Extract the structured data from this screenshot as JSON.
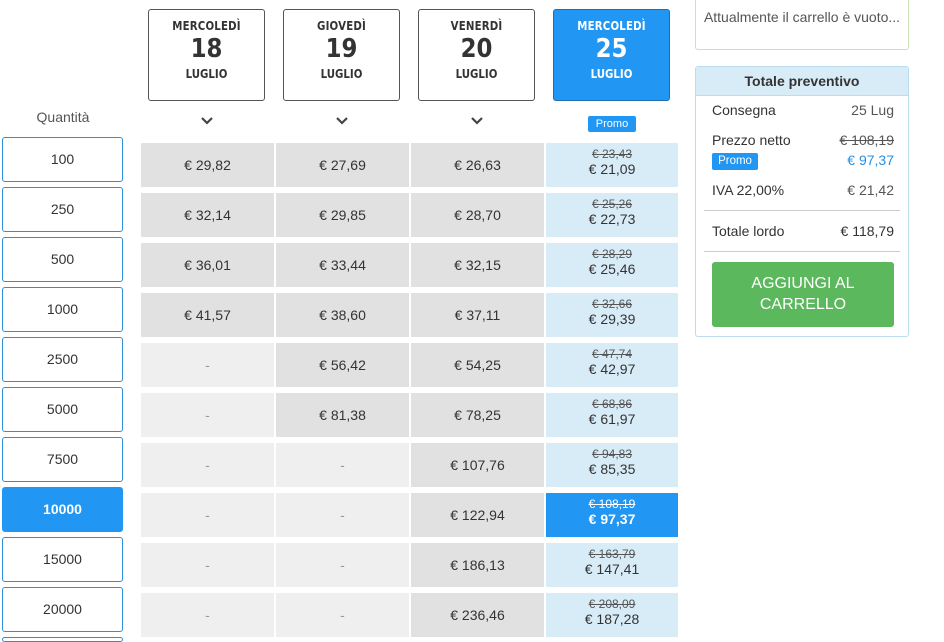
{
  "dates": [
    {
      "weekday": "MERCOLEDÌ",
      "day": "18",
      "month": "LUGLIO"
    },
    {
      "weekday": "GIOVEDÌ",
      "day": "19",
      "month": "LUGLIO"
    },
    {
      "weekday": "VENERDÌ",
      "day": "20",
      "month": "LUGLIO"
    },
    {
      "weekday": "MERCOLEDÌ",
      "day": "25",
      "month": "LUGLIO"
    }
  ],
  "promo_label": "Promo",
  "quantity_label": "Quantità",
  "quantities": [
    "100",
    "250",
    "500",
    "1000",
    "2500",
    "5000",
    "7500",
    "10000",
    "15000",
    "20000"
  ],
  "rows": [
    {
      "c1": "€ 29,82",
      "c2": "€ 27,69",
      "c3": "€ 26,63",
      "old": "€ 23,43",
      "new": "€ 21,09"
    },
    {
      "c1": "€ 32,14",
      "c2": "€ 29,85",
      "c3": "€ 28,70",
      "old": "€ 25,26",
      "new": "€ 22,73"
    },
    {
      "c1": "€ 36,01",
      "c2": "€ 33,44",
      "c3": "€ 32,15",
      "old": "€ 28,29",
      "new": "€ 25,46"
    },
    {
      "c1": "€ 41,57",
      "c2": "€ 38,60",
      "c3": "€ 37,11",
      "old": "€ 32,66",
      "new": "€ 29,39"
    },
    {
      "c1": "-",
      "c2": "€ 56,42",
      "c3": "€ 54,25",
      "old": "€ 47,74",
      "new": "€ 42,97"
    },
    {
      "c1": "-",
      "c2": "€ 81,38",
      "c3": "€ 78,25",
      "old": "€ 68,86",
      "new": "€ 61,97"
    },
    {
      "c1": "-",
      "c2": "-",
      "c3": "€ 107,76",
      "old": "€ 94,83",
      "new": "€ 85,35"
    },
    {
      "c1": "-",
      "c2": "-",
      "c3": "€ 122,94",
      "old": "€ 108,19",
      "new": "€ 97,37"
    },
    {
      "c1": "-",
      "c2": "-",
      "c3": "€ 186,13",
      "old": "€ 163,79",
      "new": "€ 147,41"
    },
    {
      "c1": "-",
      "c2": "-",
      "c3": "€ 236,46",
      "old": "€ 208,09",
      "new": "€ 187,28"
    }
  ],
  "cart": {
    "empty_text": "Attualmente il carrello è vuoto..."
  },
  "summary": {
    "title": "Totale preventivo",
    "delivery_label": "Consegna",
    "delivery_value": "25 Lug",
    "net_label": "Prezzo netto",
    "net_old": "€ 108,19",
    "promo": "Promo",
    "net_new": "€ 97,37",
    "vat_label": "IVA 22,00%",
    "vat_value": "€ 21,42",
    "total_label": "Totale lordo",
    "total_value": "€ 118,79",
    "add_button": "AGGIUNGI AL CARRELLO"
  },
  "colors": {
    "accent": "#2196f3",
    "promo_cell": "#d8ecf8",
    "add_button": "#5cb85c"
  }
}
